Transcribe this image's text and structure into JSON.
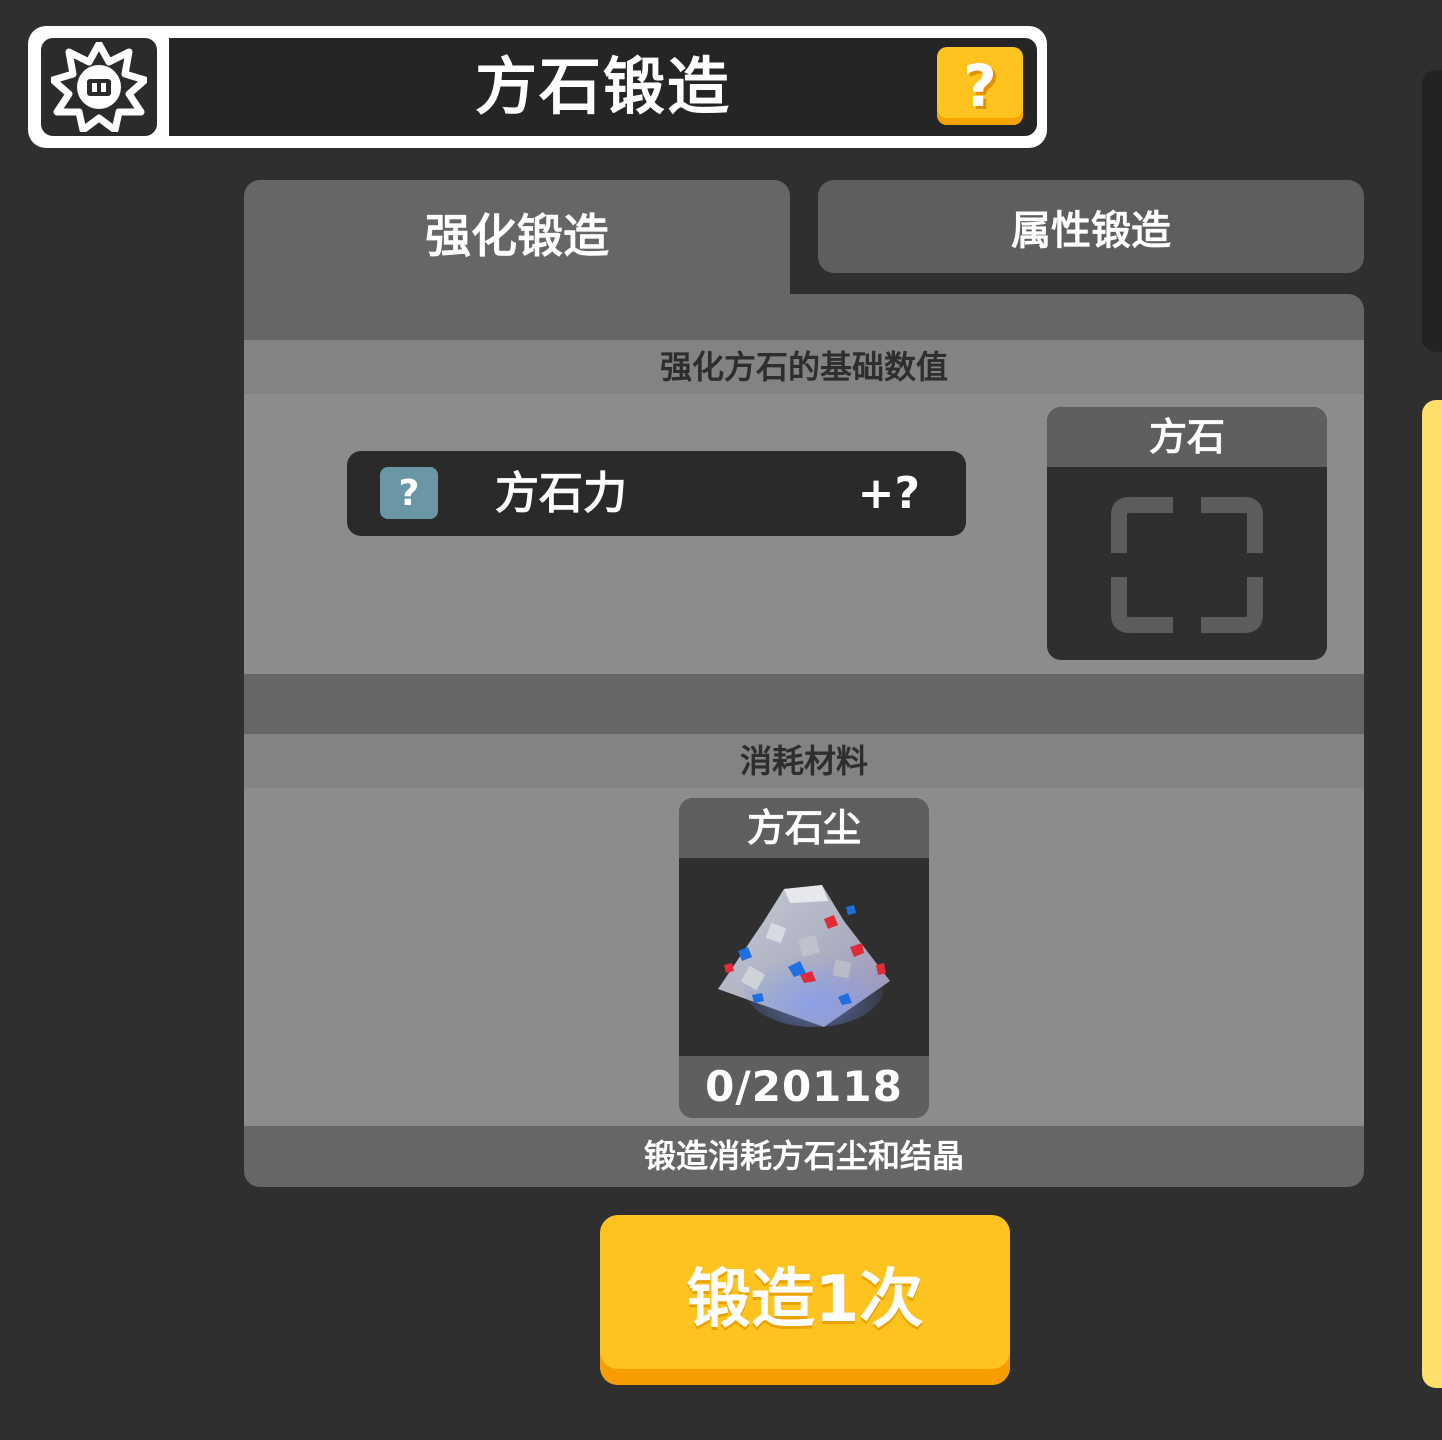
{
  "header": {
    "title": "方石锻造",
    "settings_icon": "gear-icon",
    "help_label": "?"
  },
  "tabs": [
    {
      "label": "强化锻造",
      "active": true
    },
    {
      "label": "属性锻造",
      "active": false
    }
  ],
  "stats_section": {
    "title": "强化方石的基础数值",
    "stat": {
      "icon_label": "?",
      "name": "方石力",
      "value": "+?"
    },
    "slot": {
      "title": "方石",
      "icon": "empty-slot-frame-icon"
    }
  },
  "materials_section": {
    "title": "消耗材料",
    "item": {
      "name": "方石尘",
      "icon": "ore-dust-pile-icon",
      "count": "0/20118"
    },
    "footer_note": "锻造消耗方石尘和结晶"
  },
  "forge_button": {
    "label": "锻造1次"
  },
  "colors": {
    "accent_yellow": "#ffc31f",
    "panel_gray": "#666666",
    "background": "#2f2f2f"
  }
}
